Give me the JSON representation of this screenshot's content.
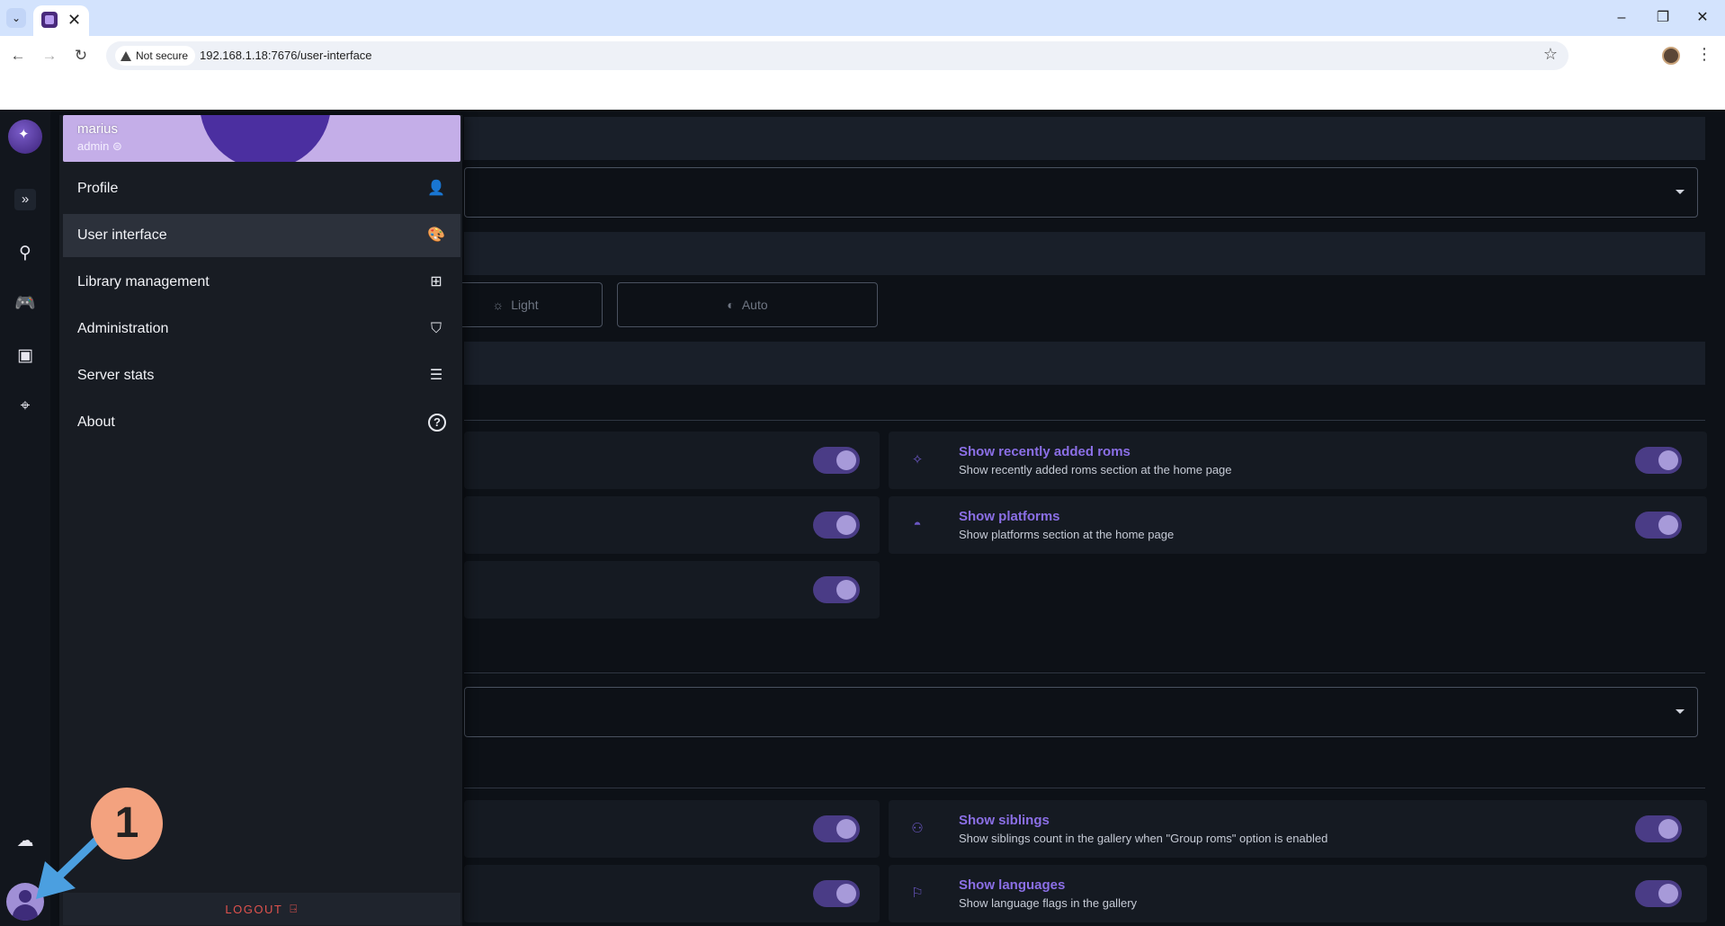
{
  "browser": {
    "tab_list_glyph": "⌄",
    "tab_close_glyph": "✕",
    "window_controls": [
      "–",
      "❐",
      "✕"
    ],
    "nav": {
      "back": "←",
      "forward": "→",
      "reload": "↻"
    },
    "security_label": "Not secure",
    "url": "192.168.1.18:7676/user-interface",
    "bookmark_glyph": "☆",
    "menu_glyph": "⋮"
  },
  "rail": {
    "expand_glyph": "»",
    "search_glyph": "⚲",
    "platforms_glyph": "🎮",
    "collections_glyph": "▣",
    "scan_glyph": "⌖",
    "upload_glyph": "☁"
  },
  "main": {
    "theme_buttons": [
      {
        "label": "Light",
        "icon": "sun-icon"
      },
      {
        "label": "Auto",
        "icon": "auto-brightness-icon"
      }
    ],
    "home_toggles_right": [
      {
        "title": "Show recently added roms",
        "desc": "Show recently added roms section at the home page",
        "icon": "sparkles-icon",
        "glyph": "✧",
        "enabled": true
      },
      {
        "title": "Show platforms",
        "desc": "Show platforms section at the home page",
        "icon": "gamepad-icon",
        "glyph": "◓",
        "enabled": true
      }
    ],
    "gallery_toggles_right": [
      {
        "title": "Show siblings",
        "desc": "Show siblings count in the gallery when \"Group roms\" option is enabled",
        "icon": "people-icon",
        "glyph": "⚇",
        "enabled": true
      },
      {
        "title": "Show languages",
        "desc": "Show language flags in the gallery",
        "icon": "flag-icon",
        "glyph": "⚐",
        "enabled": true
      }
    ],
    "hidden_toggles_enabled": [
      true,
      true,
      true,
      true,
      true
    ]
  },
  "user_menu": {
    "username": "marius",
    "role": "admin ⊜",
    "items": [
      {
        "label": "Profile",
        "icon": "person-icon",
        "glyph": "👤",
        "active": false
      },
      {
        "label": "User interface",
        "icon": "palette-icon",
        "glyph": "🎨",
        "active": true
      },
      {
        "label": "Library management",
        "icon": "library-settings-icon",
        "glyph": "⊞",
        "active": false
      },
      {
        "label": "Administration",
        "icon": "shield-icon",
        "glyph": "⛉",
        "active": false
      },
      {
        "label": "Server stats",
        "icon": "server-icon",
        "glyph": "☰",
        "active": false
      },
      {
        "label": "About",
        "icon": "help-circle-icon",
        "glyph": "?",
        "active": false
      }
    ],
    "logout_label": "LOGOUT",
    "logout_glyph": "⍈"
  },
  "annotation": {
    "step": "1",
    "color": "#f3a27f",
    "arrow_color": "#4b9fe0"
  },
  "colors": {
    "accent": "#8b6fe6",
    "switch_track": "#4a3c86",
    "logout": "#e0524d"
  }
}
